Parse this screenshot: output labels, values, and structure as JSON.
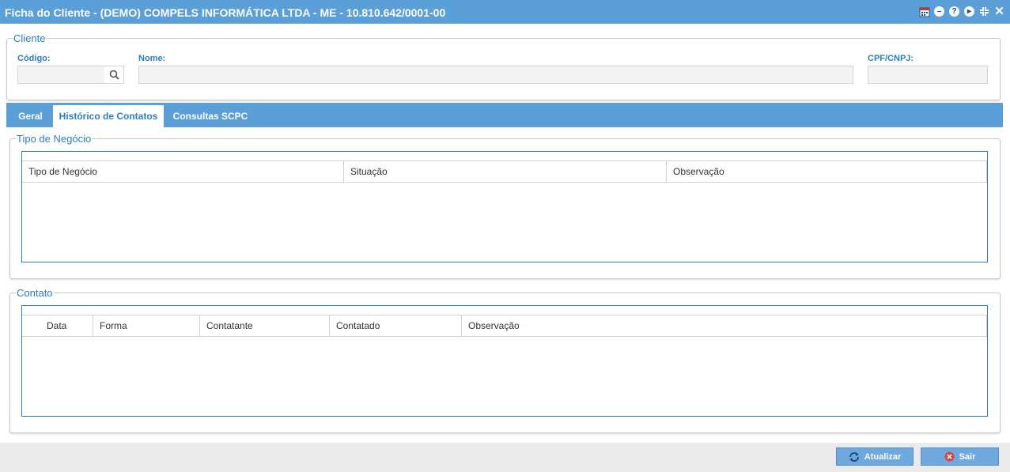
{
  "window": {
    "title": "Ficha do Cliente - (DEMO) COMPELS INFORMÁTICA LTDA - ME - 10.810.642/0001-00",
    "icons": [
      "calendar-icon",
      "minimize-icon",
      "help-icon",
      "play-icon",
      "collapse-icon",
      "close-icon"
    ]
  },
  "cliente": {
    "legend": "Cliente",
    "codigo_label": "Código:",
    "codigo_value": "",
    "nome_label": "Nome:",
    "nome_value": "",
    "cpf_label": "CPF/CNPJ:",
    "cpf_value": ""
  },
  "tabs": [
    {
      "label": "Geral",
      "active": false
    },
    {
      "label": "Histórico de Contatos",
      "active": true
    },
    {
      "label": "Consultas SCPC",
      "active": false
    }
  ],
  "tipo_negocio": {
    "legend": "Tipo de Negócio",
    "columns": [
      "Tipo de Negócio",
      "Situação",
      "Observação"
    ],
    "rows": []
  },
  "contato": {
    "legend": "Contato",
    "columns": [
      "Data",
      "Forma",
      "Contatante",
      "Contatado",
      "Observação"
    ],
    "rows": []
  },
  "footer": {
    "atualizar_label": "Atualizar",
    "sair_label": "Sair"
  },
  "colors": {
    "accent": "#5b9fd8",
    "label": "#2a7fc4"
  }
}
